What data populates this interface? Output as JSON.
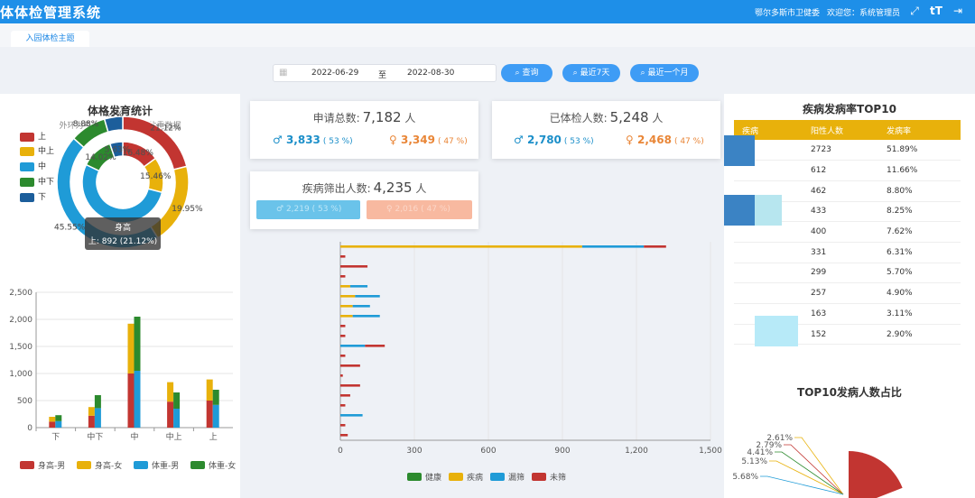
{
  "header": {
    "title": "体体检管理系统",
    "org": "鄂尔多斯市卫健委",
    "welcome": "欢迎您：系统管理员"
  },
  "tabs": [
    {
      "label": "入园体检主题"
    }
  ],
  "filters": {
    "start_date": "2022-06-29",
    "separator": "至",
    "end_date": "2022-08-30",
    "buttons": {
      "query": "查询",
      "last7": "最近7天",
      "last_month": "最近一个月"
    }
  },
  "stats": {
    "applied": {
      "label": "申请总数:",
      "value": "7,182",
      "unit": "人",
      "male": "3,833",
      "male_pct": "( 53 %)",
      "female": "3,349",
      "female_pct": "( 47 %)"
    },
    "examined": {
      "label": "已体检人数:",
      "value": "5,248",
      "unit": "人",
      "male": "2,780",
      "male_pct": "( 53 %)",
      "female": "2,468",
      "female_pct": "( 47 %)"
    },
    "screened": {
      "label": "疾病筛出人数:",
      "value": "4,235",
      "unit": "人",
      "male": "2,219",
      "male_pct": "( 53 %)",
      "female": "2,016",
      "female_pct": "( 47 %)"
    }
  },
  "growth": {
    "title": "体格发育统计",
    "subtitle": "外环为身高数据，内环为体重数据",
    "legend": [
      "上",
      "中上",
      "中",
      "中下",
      "下"
    ],
    "tooltip_title": "身高",
    "tooltip_value": "上: 892 (21.12%)"
  },
  "disease_table": {
    "title": "疾病发病率TOP10",
    "headers": [
      "疾病",
      "阳性人数",
      "发病率"
    ],
    "rows": [
      {
        "count": "2723",
        "rate": "51.89%"
      },
      {
        "count": "612",
        "rate": "11.66%"
      },
      {
        "count": "462",
        "rate": "8.80%"
      },
      {
        "count": "433",
        "rate": "8.25%"
      },
      {
        "count": "400",
        "rate": "7.62%"
      },
      {
        "count": "331",
        "rate": "6.31%"
      },
      {
        "count": "299",
        "rate": "5.70%"
      },
      {
        "count": "257",
        "rate": "4.90%"
      },
      {
        "count": "163",
        "rate": "3.11%"
      },
      {
        "count": "152",
        "rate": "2.90%"
      }
    ]
  },
  "top10_pie_title": "TOP10发病人数占比",
  "colors": {
    "primary": "#1e8fe8",
    "red": "#c23531",
    "yellow": "#e8b10b",
    "blue": "#1f9bd7",
    "green": "#2c8a2e",
    "dark_blue": "#1c5e9b",
    "male": "#1c8fc9",
    "female": "#e98637"
  },
  "chart_data": [
    {
      "type": "pie",
      "title": "体格发育统计",
      "subtitle": "外环为身高数据，内环为体重数据",
      "categories": [
        "上",
        "中上",
        "中",
        "中下",
        "下"
      ],
      "series": [
        {
          "name": "身高",
          "values": [
            21.12,
            19.95,
            45.55,
            8.88,
            4.5
          ],
          "labels": [
            "21.12%",
            "19.95%",
            "45.55%",
            "8.88%",
            "4.5%"
          ]
        },
        {
          "name": "体重",
          "values": [
            16.48,
            15.46,
            58.41,
            14.02,
            5.63
          ],
          "labels": [
            "16.48%",
            "15.46%",
            "",
            "14.02%",
            "5.63%"
          ]
        }
      ]
    },
    {
      "type": "bar",
      "stacked": true,
      "categories": [
        "下",
        "中下",
        "中",
        "中上",
        "上"
      ],
      "ylim": [
        0,
        2500
      ],
      "yticks": [
        "0",
        "500",
        "1,000",
        "1,500",
        "2,000",
        "2,500"
      ],
      "series": [
        {
          "name": "身高-男",
          "stack": "身高",
          "values": [
            110,
            220,
            1000,
            480,
            500
          ]
        },
        {
          "name": "身高-女",
          "stack": "身高",
          "values": [
            90,
            160,
            920,
            360,
            390
          ]
        },
        {
          "name": "体重-男",
          "stack": "体重",
          "values": [
            120,
            360,
            1050,
            350,
            420
          ]
        },
        {
          "name": "体重-女",
          "stack": "体重",
          "values": [
            110,
            240,
            1000,
            300,
            280
          ]
        }
      ]
    },
    {
      "type": "bar",
      "orientation": "horizontal",
      "xlim": [
        0,
        1500
      ],
      "xticks": [
        "0",
        "300",
        "600",
        "900",
        "1,200",
        "1,500"
      ],
      "series_names": [
        "健康",
        "疾病",
        "漏筛",
        "未筛"
      ],
      "rows": [
        [
          0,
          0,
          0,
          30
        ],
        [
          0,
          0,
          0,
          20
        ],
        [
          0,
          0,
          90,
          0
        ],
        [
          0,
          0,
          0,
          20
        ],
        [
          0,
          0,
          0,
          40
        ],
        [
          0,
          0,
          0,
          80
        ],
        [
          0,
          0,
          0,
          10
        ],
        [
          0,
          0,
          0,
          80
        ],
        [
          0,
          0,
          0,
          20
        ],
        [
          0,
          0,
          100,
          80
        ],
        [
          0,
          0,
          0,
          20
        ],
        [
          0,
          0,
          0,
          20
        ],
        [
          0,
          50,
          110,
          0
        ],
        [
          0,
          50,
          70,
          0
        ],
        [
          0,
          60,
          100,
          0
        ],
        [
          0,
          40,
          70,
          0
        ],
        [
          0,
          0,
          0,
          20
        ],
        [
          0,
          0,
          0,
          110
        ],
        [
          0,
          0,
          0,
          20
        ],
        [
          0,
          980,
          250,
          90
        ]
      ]
    },
    {
      "type": "pie",
      "title": "TOP10发病人数占比",
      "labels": [
        "2.61%",
        "2.79%",
        "4.41%",
        "5.13%",
        "5.68%"
      ]
    }
  ]
}
